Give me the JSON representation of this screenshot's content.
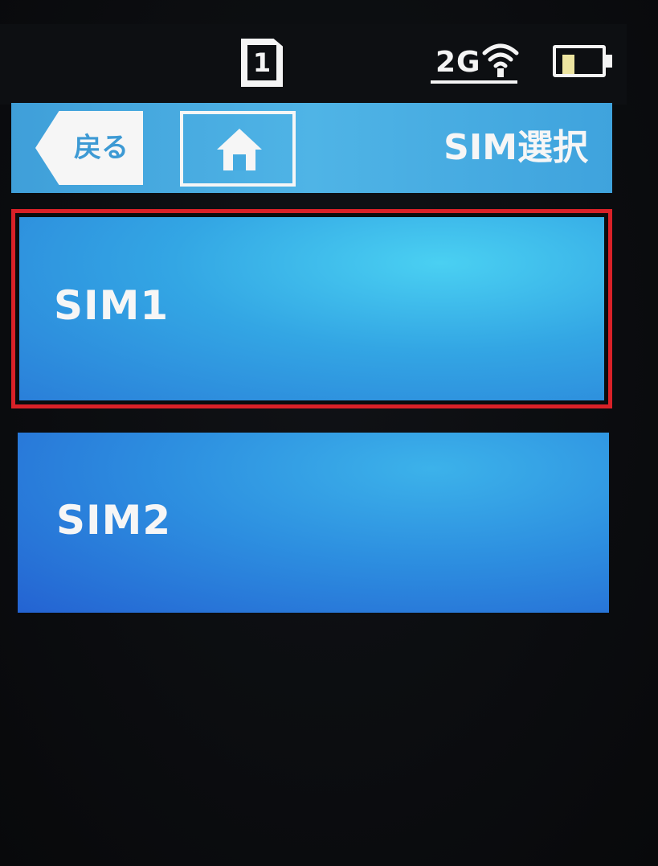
{
  "status_bar": {
    "sim_slot": "1",
    "network_type": "2G",
    "battery_level": 0.3,
    "icons": [
      "sim-card-icon",
      "wifi-signal-icon",
      "battery-icon"
    ]
  },
  "header": {
    "back_label": "戻る",
    "home_icon": "home-icon",
    "title": "SIM選択"
  },
  "options": [
    {
      "label": "SIM1",
      "selected": true
    },
    {
      "label": "SIM2",
      "selected": false
    }
  ],
  "colors": {
    "header": "#4fb4e6",
    "option": "#2d8fe0",
    "selection_outline": "#d92128",
    "text": "#f6f6f6"
  }
}
